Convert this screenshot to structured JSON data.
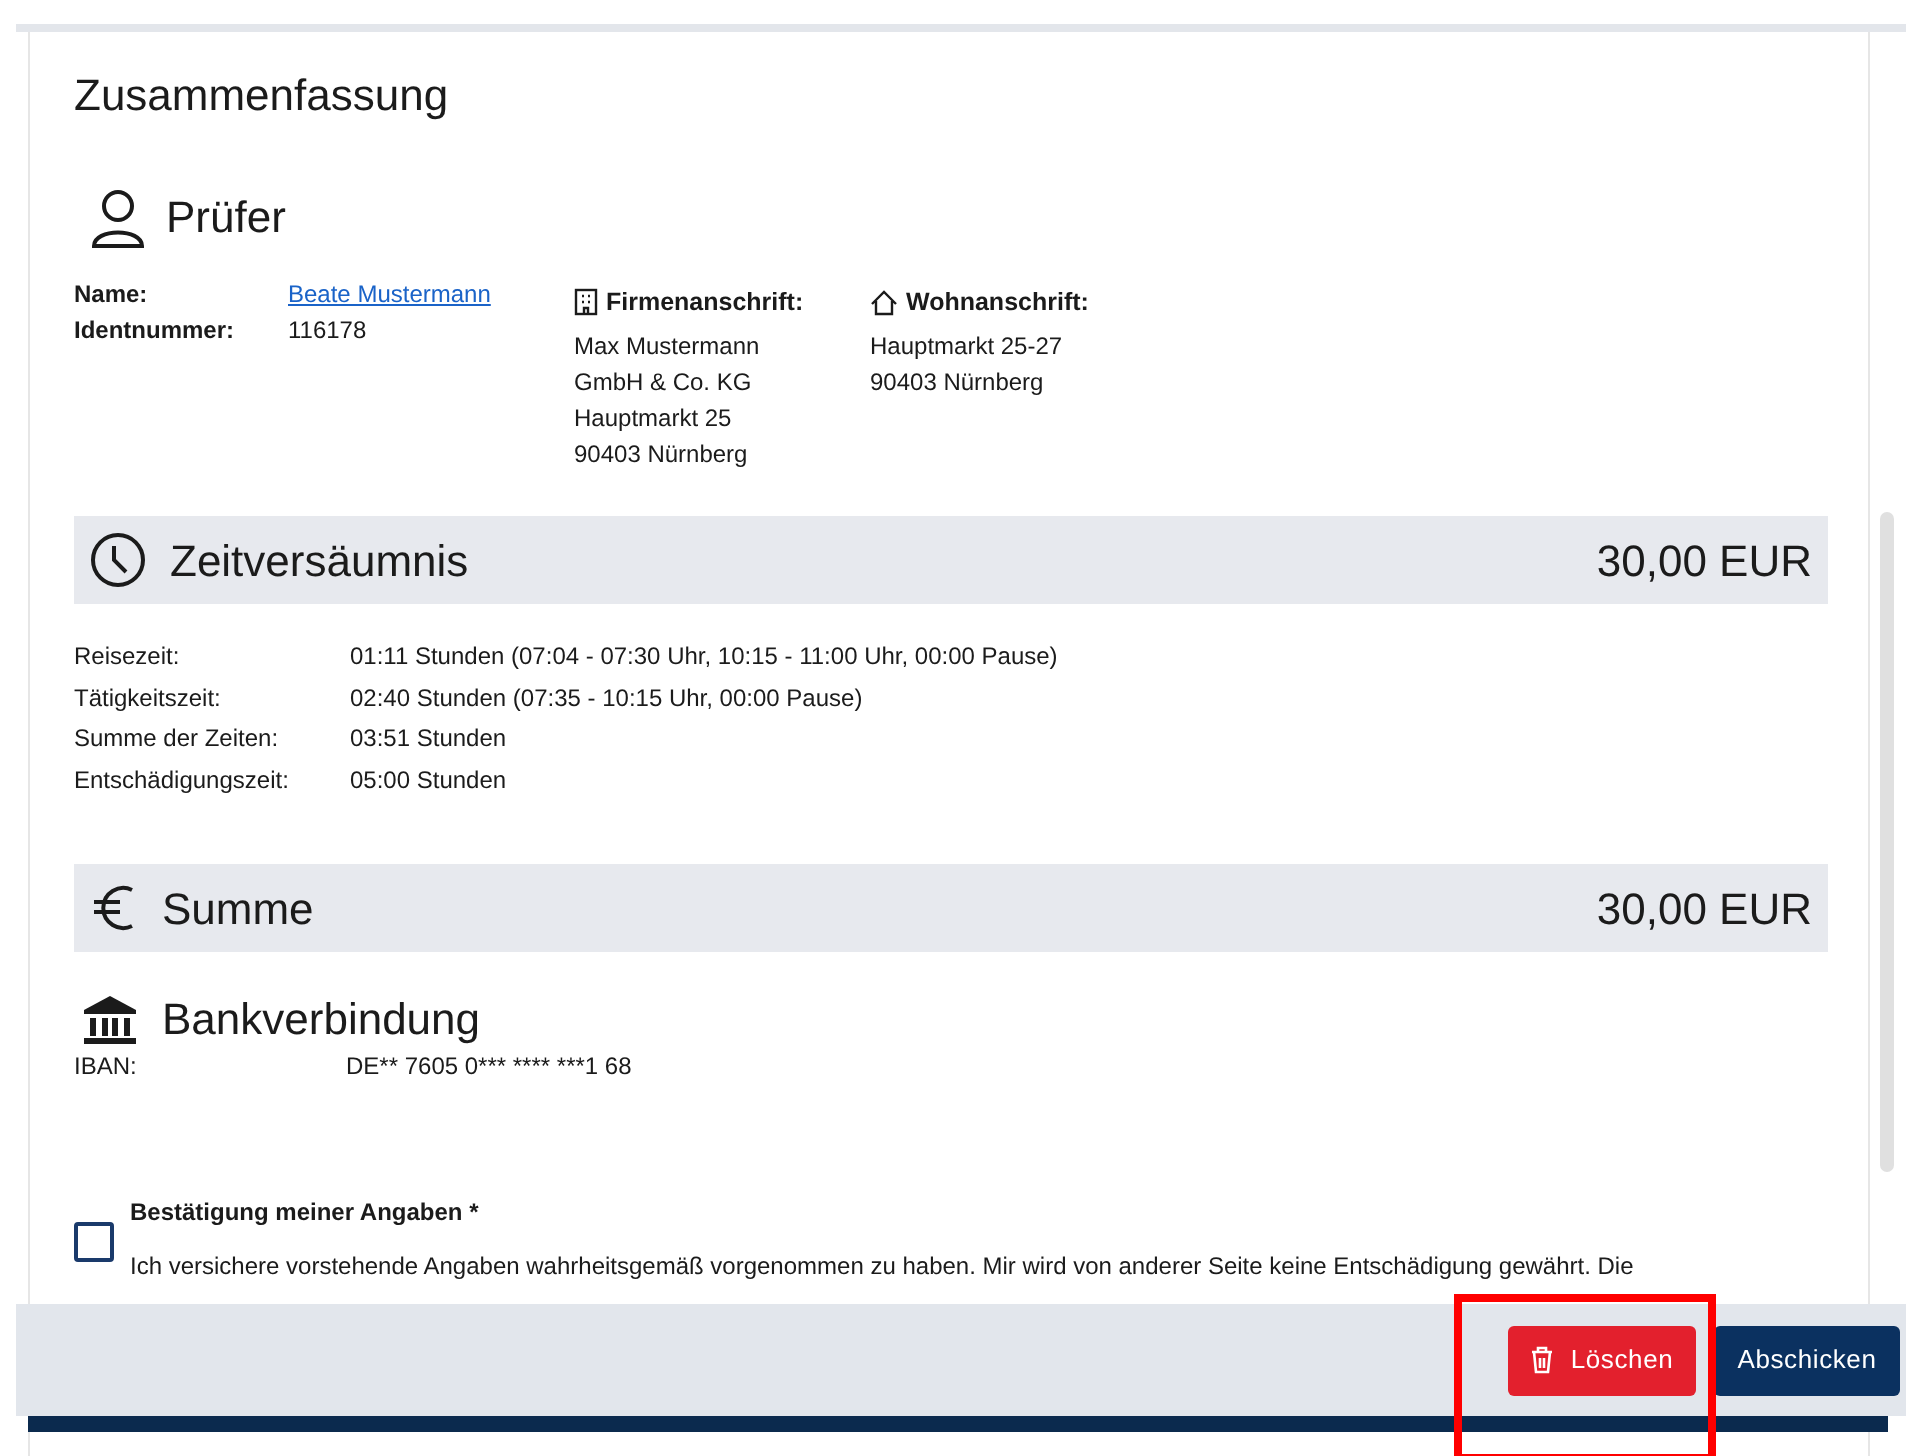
{
  "title": "Zusammenfassung",
  "pruefer": {
    "heading": "Prüfer",
    "fields": [
      {
        "label": "Name:",
        "value": "Beate Mustermann",
        "kind": "link"
      },
      {
        "label": "Identnummer:",
        "value": "116178",
        "kind": "text"
      }
    ],
    "company": {
      "label": "Firmenanschrift:",
      "lines": [
        "Max Mustermann",
        "GmbH & Co. KG",
        "Hauptmarkt 25",
        "90403 Nürnberg"
      ]
    },
    "home": {
      "label": "Wohnanschrift:",
      "lines": [
        "Hauptmarkt 25-27",
        "90403 Nürnberg"
      ]
    }
  },
  "zeitversaeumnis": {
    "heading": "Zeitversäumnis",
    "amount": "30,00 EUR",
    "rows": [
      {
        "label": "Reisezeit:",
        "value": "01:11 Stunden (07:04 - 07:30 Uhr, 10:15 - 11:00 Uhr, 00:00 Pause)"
      },
      {
        "label": "Tätigkeitszeit:",
        "value": "02:40 Stunden (07:35 - 10:15 Uhr, 00:00 Pause)"
      },
      {
        "label": "Summe der Zeiten:",
        "value": "03:51 Stunden"
      },
      {
        "label": "Entschädigungszeit:",
        "value": "05:00 Stunden"
      }
    ]
  },
  "summe": {
    "heading": "Summe",
    "amount": "30,00 EUR"
  },
  "bank": {
    "heading": "Bankverbindung",
    "rows": [
      {
        "label": "IBAN:",
        "value": "DE** 7605 0*** **** ***1 68"
      }
    ]
  },
  "confirmation": {
    "checked": false,
    "label": "Bestätigung meiner Angaben *",
    "text": "Ich versichere vorstehende Angaben wahrheitsgemäß vorgenommen zu haben. Mir wird von anderer Seite keine Entschädigung gewährt. Die"
  },
  "buttons": [
    {
      "label": "Löschen",
      "kind": "delete"
    },
    {
      "label": "Abschicken",
      "kind": "submit"
    }
  ]
}
